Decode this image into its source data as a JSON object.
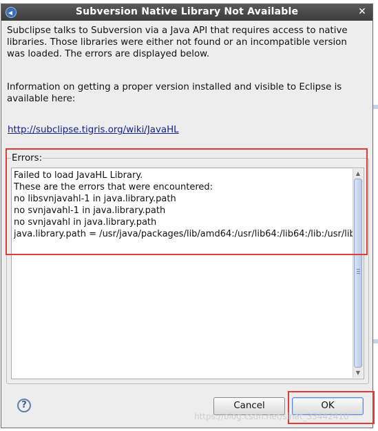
{
  "dialog": {
    "title": "Subversion Native Library Not Available",
    "close_glyph": "✕",
    "message": "Subclipse talks to Subversion via a Java API that requires access to native libraries.  Those libraries were either not found or an incompatible version was loaded.  The errors are displayed below.",
    "info": "Information on getting a proper version installed and visible to Eclipse is available here:",
    "link": "http://subclipse.tigris.org/wiki/JavaHL",
    "errors_label": "Errors:",
    "errors_text": "Failed to load JavaHL Library.\nThese are the errors that were encountered:\nno libsvnjavahl-1 in java.library.path\nno svnjavahl-1 in java.library.path\nno svnjavahl in java.library.path\njava.library.path = /usr/java/packages/lib/amd64:/usr/lib64:/lib64:/lib:/usr/lib",
    "help_glyph": "?",
    "cancel_label": "Cancel",
    "ok_label": "OK"
  },
  "watermark": "https://blog.csdn.net/sinat_33442410",
  "colors": {
    "titlebar": "#4a4a4a",
    "highlight": "#e03b3b",
    "link": "#10208a"
  }
}
